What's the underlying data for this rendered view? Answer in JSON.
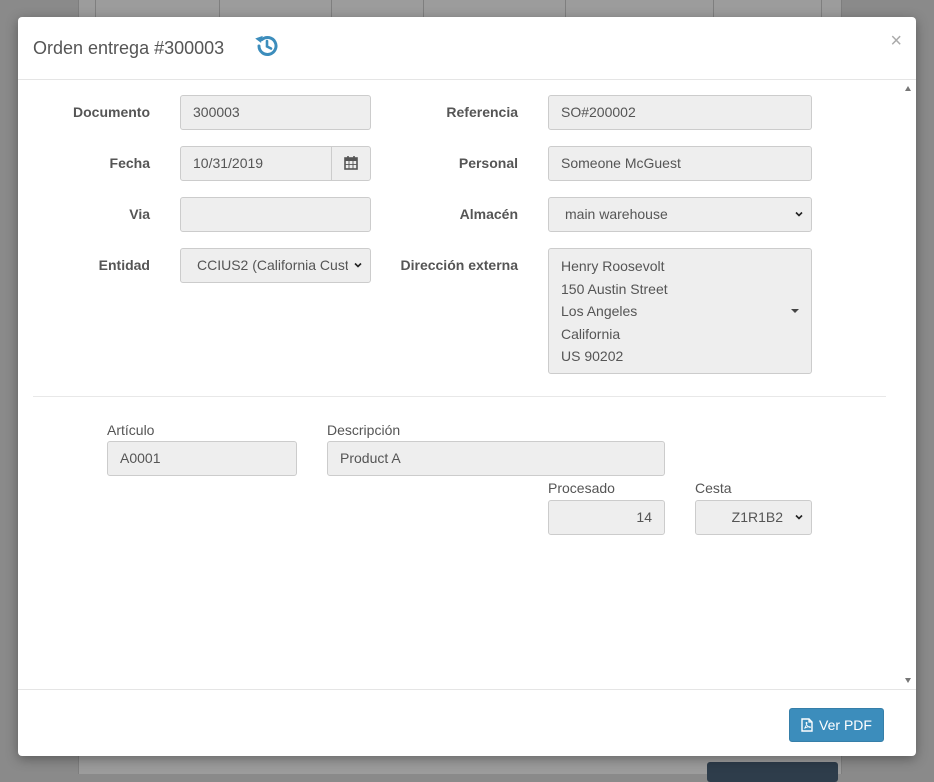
{
  "modal": {
    "title": "Orden entrega #300003",
    "close_label": "×"
  },
  "header_fields": {
    "documento": {
      "label": "Documento",
      "value": "300003"
    },
    "referencia": {
      "label": "Referencia",
      "value": "SO#200002"
    },
    "fecha": {
      "label": "Fecha",
      "value": "10/31/2019"
    },
    "personal": {
      "label": "Personal",
      "value": "Someone McGuest"
    },
    "via": {
      "label": "Via",
      "value": ""
    },
    "almacen": {
      "label": "Almacén",
      "value": "main warehouse"
    },
    "entidad": {
      "label": "Entidad",
      "value": "CCIUS2 (California Cust"
    },
    "direccion": {
      "label": "Dirección externa",
      "lines": [
        "Henry Roosevolt",
        "150 Austin Street",
        "Los Angeles",
        "California",
        "US 90202"
      ]
    }
  },
  "line_item": {
    "articulo": {
      "label": "Artículo",
      "value": "A0001"
    },
    "descripcion": {
      "label": "Descripción",
      "value": "Product A"
    },
    "procesado": {
      "label": "Procesado",
      "value": "14"
    },
    "cesta": {
      "label": "Cesta",
      "value": "Z1R1B2"
    }
  },
  "footer": {
    "pdf_label": "Ver PDF"
  },
  "icons": {
    "history": "history-icon",
    "calendar": "calendar-icon",
    "pdf": "file-pdf-icon"
  },
  "colors": {
    "accent": "#3c8dbc",
    "field_bg": "#eeeeee"
  }
}
